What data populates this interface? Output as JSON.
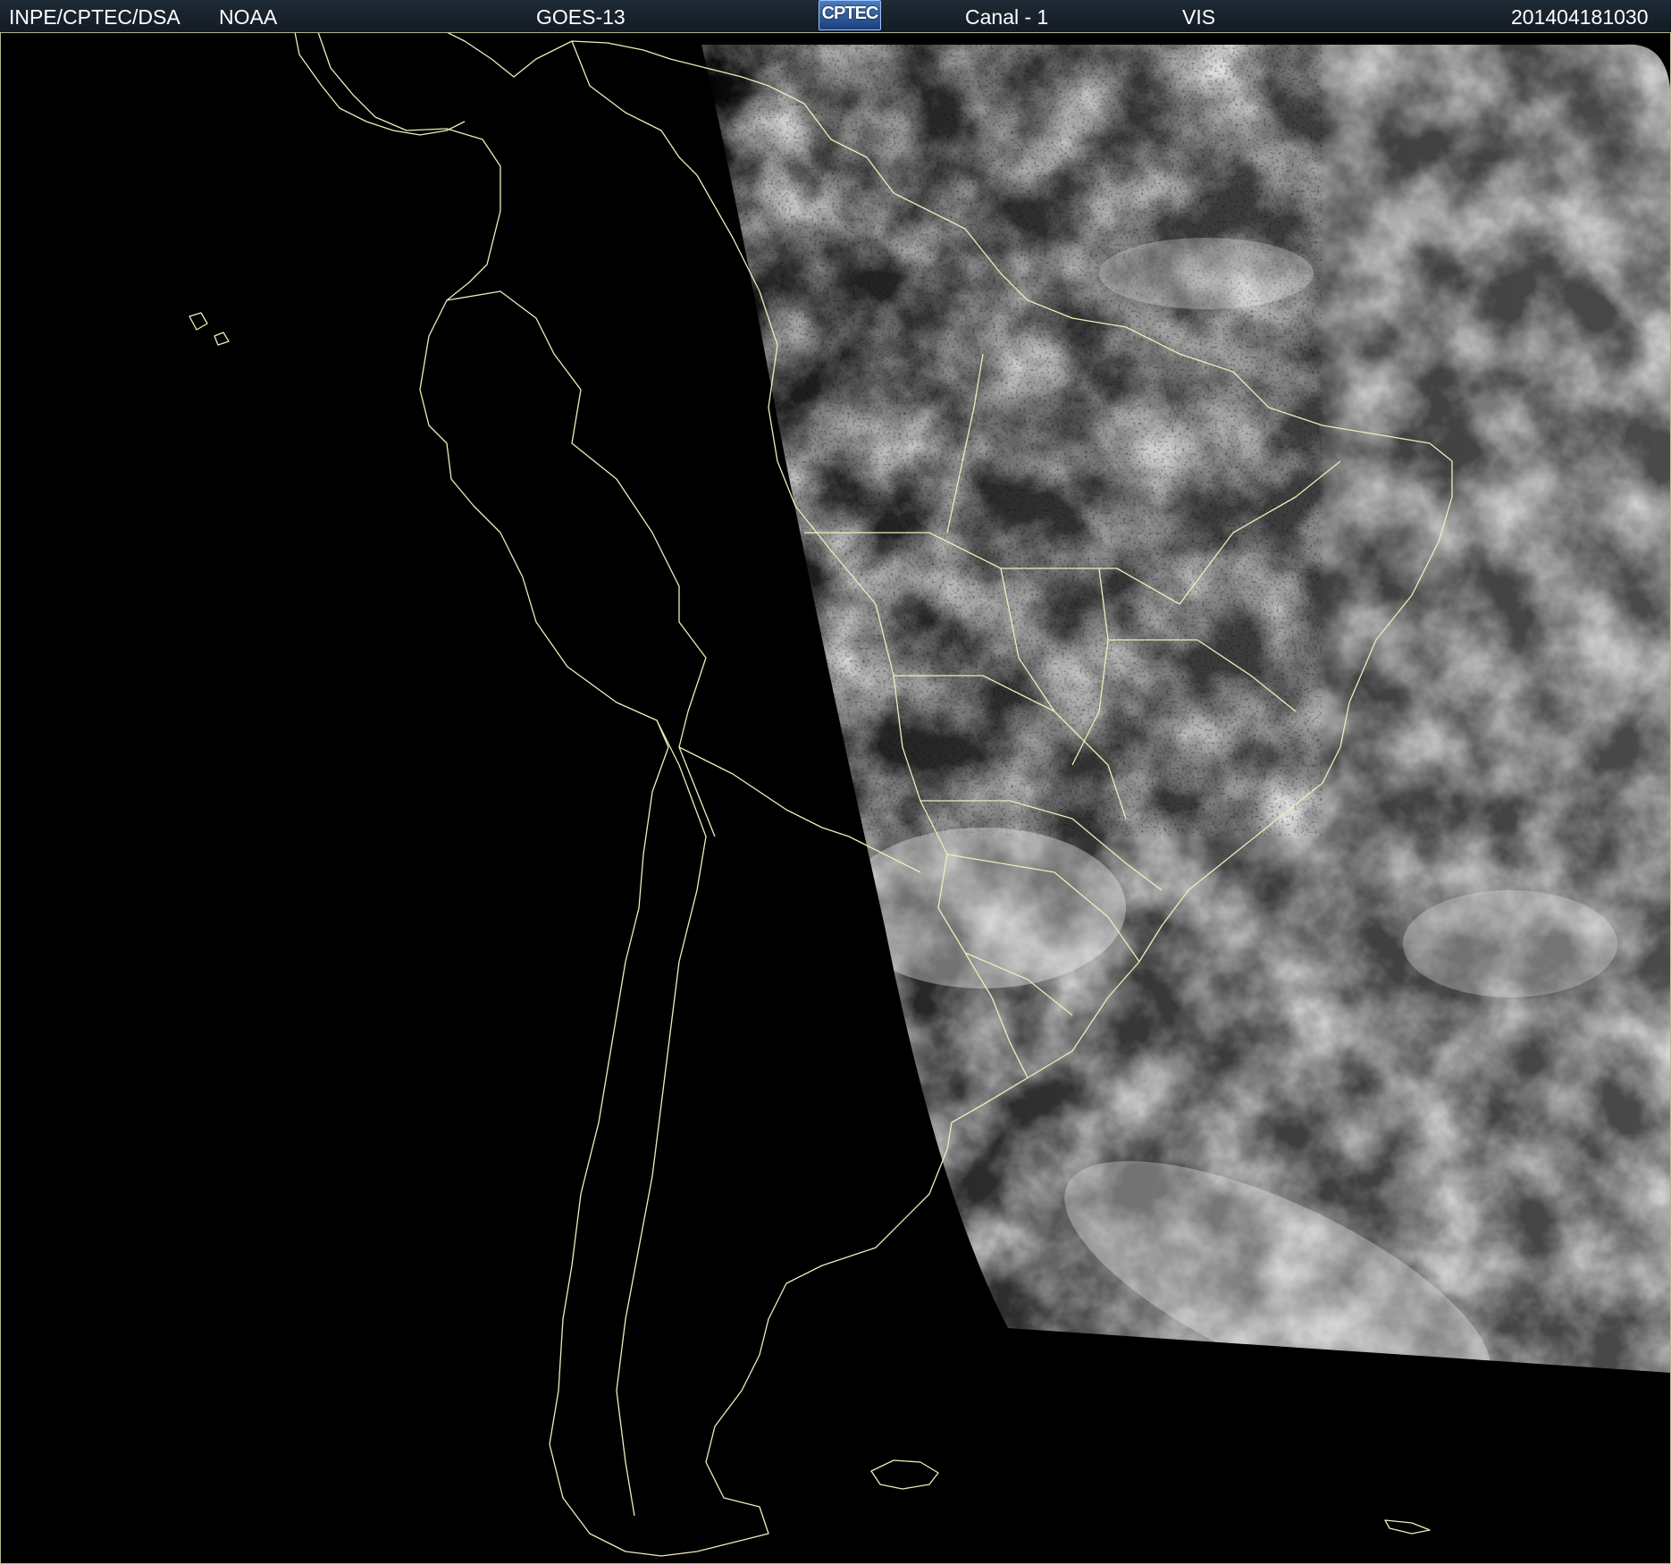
{
  "header": {
    "org": "INPE/CPTEC/DSA",
    "agency": "NOAA",
    "satellite": "GOES-13",
    "logo_text": "CPTEC",
    "channel": "Canal - 1",
    "band": "VIS",
    "timestamp": "201404181030"
  },
  "colors": {
    "background": "#000000",
    "coastline": "#eeeebb",
    "header_bg": "#19222c"
  },
  "icons": {
    "logo": "cptec-logo"
  }
}
